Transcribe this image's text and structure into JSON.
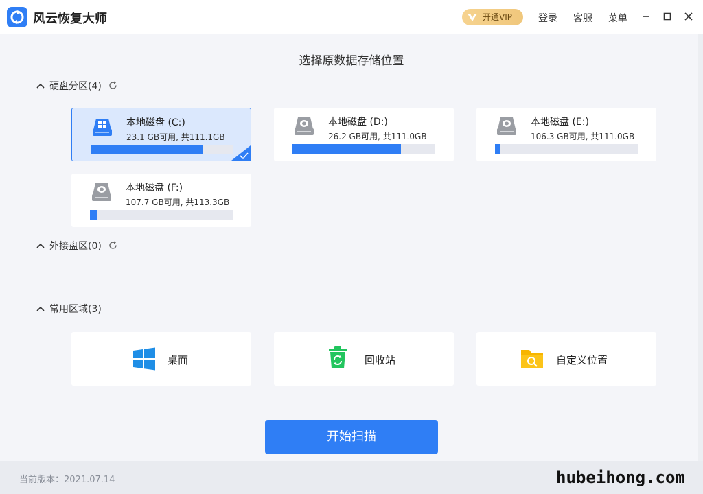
{
  "app": {
    "name": "风云恢复大师"
  },
  "topbar": {
    "vip_label": "开通VIP",
    "login_label": "登录",
    "service_label": "客服",
    "menu_label": "菜单"
  },
  "page_title": "选择原数据存储位置",
  "sections": {
    "hard_disk": {
      "label": "硬盘分区(4)"
    },
    "external": {
      "label": "外接盘区(0)"
    },
    "common": {
      "label": "常用区域(3)"
    }
  },
  "disks": [
    {
      "name": "本地磁盘 (C:)",
      "size_text": "23.1 GB可用, 共111.1GB",
      "used_fraction": 0.79,
      "selected": true
    },
    {
      "name": "本地磁盘 (D:)",
      "size_text": "26.2 GB可用, 共111.0GB",
      "used_fraction": 0.76,
      "selected": false
    },
    {
      "name": "本地磁盘 (E:)",
      "size_text": "106.3 GB可用, 共111.0GB",
      "used_fraction": 0.04,
      "selected": false
    },
    {
      "name": "本地磁盘 (F:)",
      "size_text": "107.7 GB可用, 共113.3GB",
      "used_fraction": 0.05,
      "selected": false
    }
  ],
  "places": [
    {
      "label": "桌面",
      "icon": "windows-icon"
    },
    {
      "label": "回收站",
      "icon": "recycle-bin-icon"
    },
    {
      "label": "自定义位置",
      "icon": "folder-search-icon"
    }
  ],
  "scan_button_label": "开始扫描",
  "footer": {
    "version_text": "当前版本：2021.07.14"
  },
  "watermark": "hubeihong.com",
  "colors": {
    "accent": "#2f7ef5",
    "selected_bg": "#dbe8fd",
    "vip_gold": "#f0c77c",
    "recycle_green": "#22c55e",
    "folder_yellow": "#f7b500"
  }
}
